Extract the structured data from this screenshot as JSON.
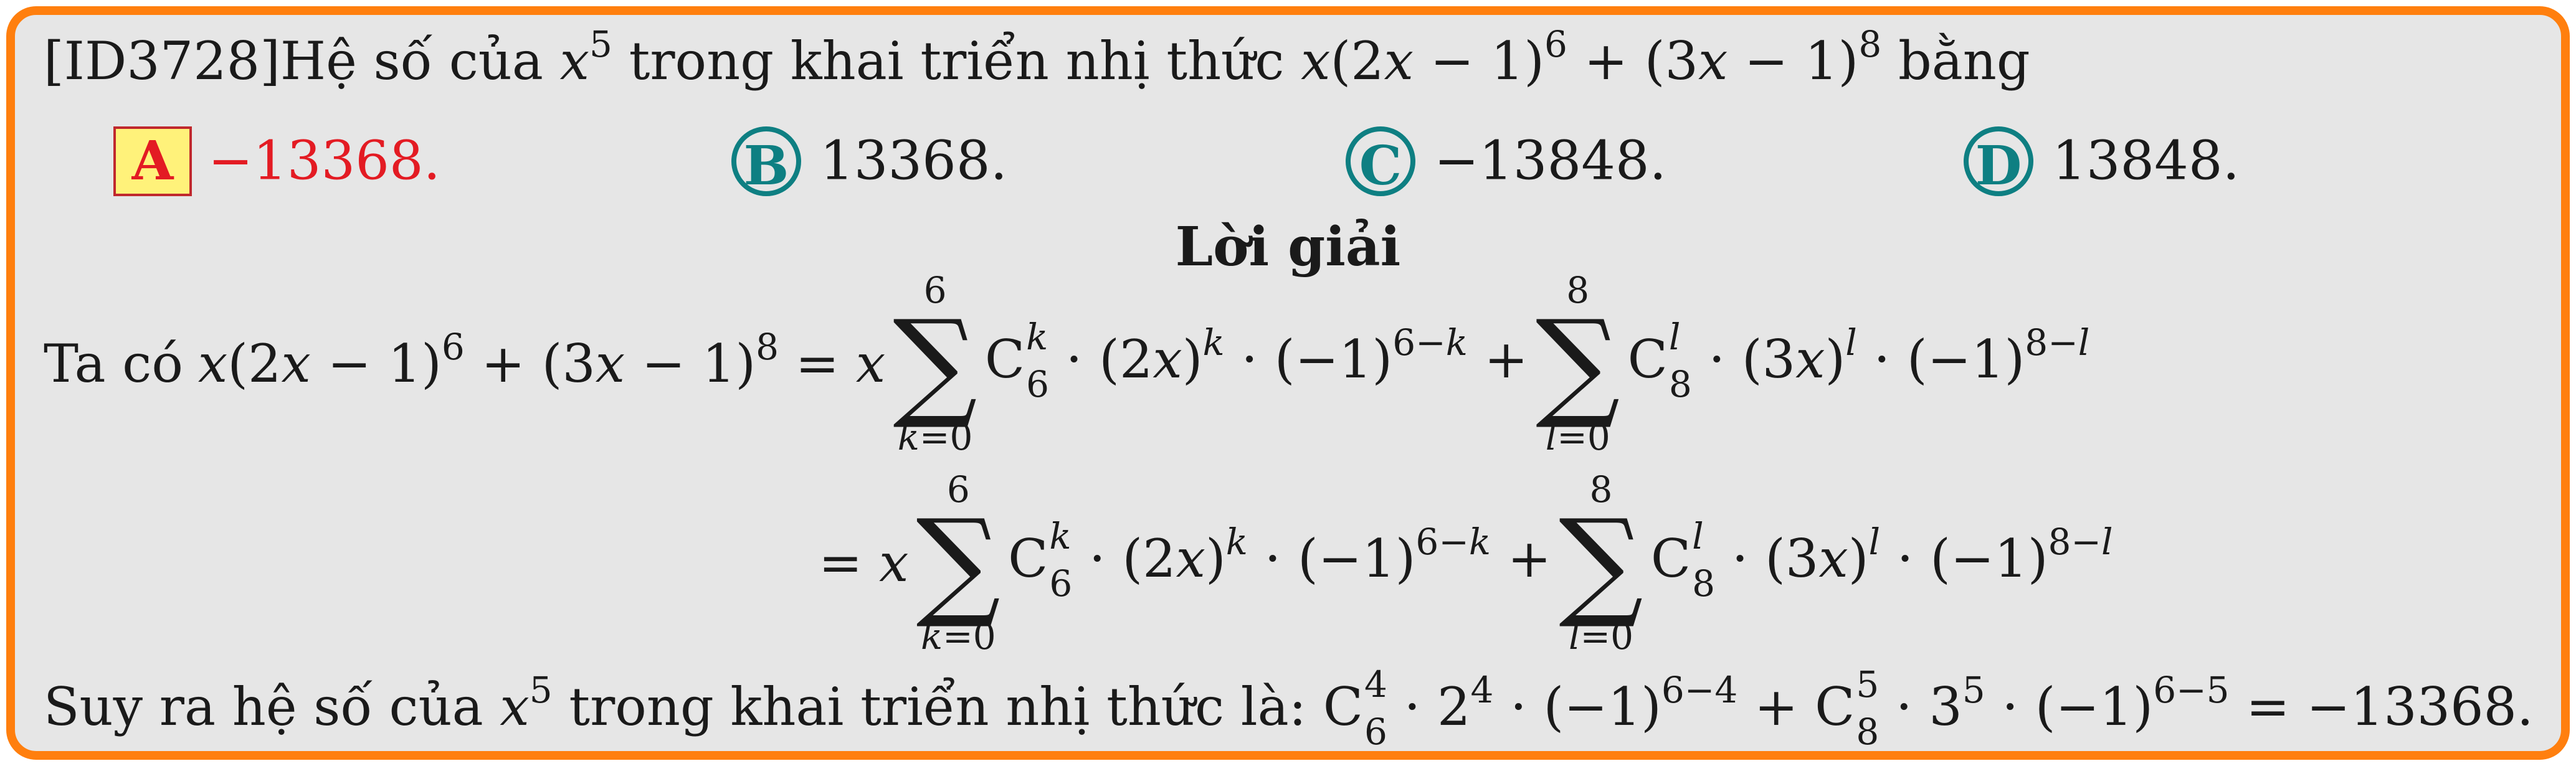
{
  "question": {
    "id": "[ID3728]",
    "text": "Hệ số của",
    "var_base": "x",
    "var_exp": "5",
    "text2": "trong khai triển nhị thức",
    "text3": "bằng"
  },
  "choices": [
    {
      "letter": "A",
      "value": "−13368.",
      "selected": true
    },
    {
      "letter": "B",
      "value": "13368.",
      "selected": false
    },
    {
      "letter": "C",
      "value": "−13848.",
      "selected": false
    },
    {
      "letter": "D",
      "value": "13848.",
      "selected": false
    }
  ],
  "solution": {
    "heading": "Lời giải",
    "intro": "Ta có",
    "conclusion_text": "Suy ra hệ số của",
    "conclusion_text2": "trong khai triển nhị thức là:",
    "result": "−13368."
  },
  "colors": {
    "border": "#ff7f0e",
    "background": "#e6e6e6",
    "answer_red": "#e31b23",
    "badge_teal": "#0e7f82",
    "badge_fill": "#fff27a"
  }
}
